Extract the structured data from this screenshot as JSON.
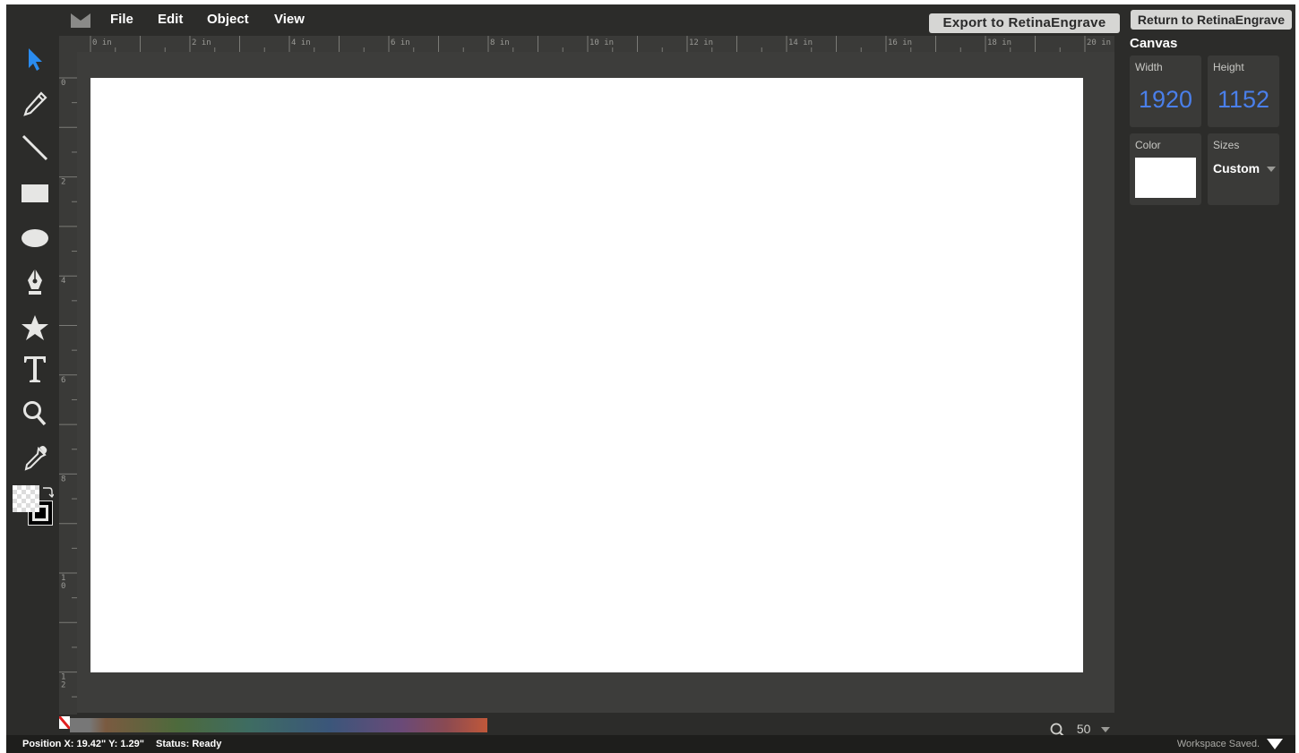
{
  "menubar": {
    "items": [
      "File",
      "Edit",
      "Object",
      "View"
    ],
    "export_button": "Export to RetinaEngrave",
    "return_button": "Return to RetinaEngrave"
  },
  "toolbox": {
    "tools": [
      "select-tool",
      "pencil-tool",
      "line-tool",
      "rectangle-tool",
      "ellipse-tool",
      "pen-tool",
      "star-tool",
      "text-tool",
      "zoom-tool",
      "eyedropper-tool"
    ],
    "active_tool": "select-tool",
    "active_color": "#2a8cf0"
  },
  "rulers": {
    "horizontal": [
      "0 in",
      "2 in",
      "4 in",
      "6 in",
      "8 in",
      "10 in",
      "12 in",
      "14 in",
      "16 in",
      "18 in",
      "20 in"
    ],
    "vertical": [
      "0",
      "2",
      "4",
      "6",
      "8",
      "10",
      "12"
    ]
  },
  "panel": {
    "title": "Canvas",
    "width_label": "Width",
    "width_value": "1920",
    "height_label": "Height",
    "height_value": "1152",
    "color_label": "Color",
    "color_value": "#ffffff",
    "sizes_label": "Sizes",
    "sizes_value": "Custom"
  },
  "zoom": {
    "value": "50"
  },
  "status": {
    "position": "Position X: 19.42\" Y: 1.29\"",
    "status": "Status: Ready",
    "saved": "Workspace Saved."
  },
  "colors": {
    "accent": "#4a7fea",
    "background": "#2c2c2a",
    "canvas": "#ffffff"
  }
}
